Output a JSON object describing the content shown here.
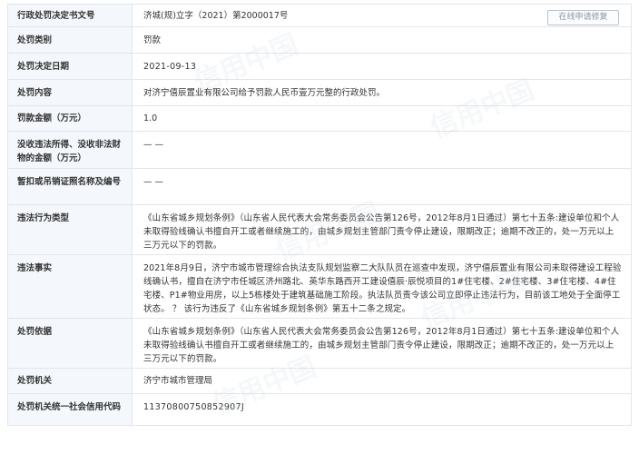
{
  "rows": [
    {
      "label": "行政处罚决定书文号",
      "value": "济城(规)立字（2021）第2000017号",
      "button": "在线申请修复"
    },
    {
      "label": "处罚类别",
      "value": "罚款"
    },
    {
      "label": "处罚决定日期",
      "value": "2021-09-13"
    },
    {
      "label": "处罚内容",
      "value": "对济宁僖辰置业有限公司给予罚款人民币壹万元整的行政处罚。"
    },
    {
      "label": "罚款金额（万元）",
      "value": "1.0"
    },
    {
      "label": "没收违法所得、没收非法财物的金额（万元）",
      "value": "— —"
    },
    {
      "label": "暂扣或吊销证照名称及编号",
      "value": "— —"
    },
    {
      "label": "违法行为类型",
      "value": "《山东省城乡规划条例》（山东省人民代表大会常务委员会公告第126号，2012年8月1日通过）第七十五条:建设单位和个人未取得验线确认书擅自开工或者继续施工的，由城乡规划主管部门责令停止建设，限期改正；逾期不改正的，处一万元以上三万元以下的罚款。"
    },
    {
      "label": "违法事实",
      "value": "2021年8月9日，济宁市城市管理综合执法支队规划监察二大队队员在巡查中发现，济宁僖辰置业有限公司未取得建设工程验线确认书，擅自在济宁市任城区济州路北、英华东路西开工建设僖辰·辰悦项目的1#住宅楼、2#住宅楼、3#住宅楼、4#住宅楼、P1#物业用房，以上5栋楼处于建筑基础施工阶段。执法队员责令该公司立即停止违法行为，目前该工地处于全面停工状态。 ？ 该行为违反了《山东省城乡规划条例》第五十二条之规定。"
    },
    {
      "label": "处罚依据",
      "value": "《山东省城乡规划条例》（山东省人民代表大会常务委员会公告第126号，2012年8月1日通过）第七十五条:建设单位和个人未取得验线确认书擅自开工或者继续施工的，由城乡规划主管部门责令停止建设，限期改正；逾期不改正的，处一万元以上三万元以下的罚款。"
    },
    {
      "label": "处罚机关",
      "value": "济宁市城市管理局"
    },
    {
      "label": "处罚机关统一社会信用代码",
      "value": "11370800750852907J"
    }
  ],
  "watermark": "信用中国"
}
